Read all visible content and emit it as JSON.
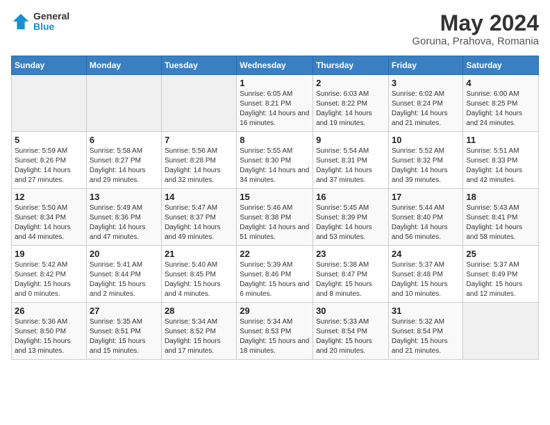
{
  "header": {
    "logo_line1": "General",
    "logo_line2": "Blue",
    "title": "May 2024",
    "subtitle": "Goruna, Prahova, Romania"
  },
  "weekdays": [
    "Sunday",
    "Monday",
    "Tuesday",
    "Wednesday",
    "Thursday",
    "Friday",
    "Saturday"
  ],
  "weeks": [
    [
      {
        "day": "",
        "info": ""
      },
      {
        "day": "",
        "info": ""
      },
      {
        "day": "",
        "info": ""
      },
      {
        "day": "1",
        "info": "Sunrise: 6:05 AM\nSunset: 8:21 PM\nDaylight: 14 hours and 16 minutes."
      },
      {
        "day": "2",
        "info": "Sunrise: 6:03 AM\nSunset: 8:22 PM\nDaylight: 14 hours and 19 minutes."
      },
      {
        "day": "3",
        "info": "Sunrise: 6:02 AM\nSunset: 8:24 PM\nDaylight: 14 hours and 21 minutes."
      },
      {
        "day": "4",
        "info": "Sunrise: 6:00 AM\nSunset: 8:25 PM\nDaylight: 14 hours and 24 minutes."
      }
    ],
    [
      {
        "day": "5",
        "info": "Sunrise: 5:59 AM\nSunset: 8:26 PM\nDaylight: 14 hours and 27 minutes."
      },
      {
        "day": "6",
        "info": "Sunrise: 5:58 AM\nSunset: 8:27 PM\nDaylight: 14 hours and 29 minutes."
      },
      {
        "day": "7",
        "info": "Sunrise: 5:56 AM\nSunset: 8:28 PM\nDaylight: 14 hours and 32 minutes."
      },
      {
        "day": "8",
        "info": "Sunrise: 5:55 AM\nSunset: 8:30 PM\nDaylight: 14 hours and 34 minutes."
      },
      {
        "day": "9",
        "info": "Sunrise: 5:54 AM\nSunset: 8:31 PM\nDaylight: 14 hours and 37 minutes."
      },
      {
        "day": "10",
        "info": "Sunrise: 5:52 AM\nSunset: 8:32 PM\nDaylight: 14 hours and 39 minutes."
      },
      {
        "day": "11",
        "info": "Sunrise: 5:51 AM\nSunset: 8:33 PM\nDaylight: 14 hours and 42 minutes."
      }
    ],
    [
      {
        "day": "12",
        "info": "Sunrise: 5:50 AM\nSunset: 8:34 PM\nDaylight: 14 hours and 44 minutes."
      },
      {
        "day": "13",
        "info": "Sunrise: 5:49 AM\nSunset: 8:36 PM\nDaylight: 14 hours and 47 minutes."
      },
      {
        "day": "14",
        "info": "Sunrise: 5:47 AM\nSunset: 8:37 PM\nDaylight: 14 hours and 49 minutes."
      },
      {
        "day": "15",
        "info": "Sunrise: 5:46 AM\nSunset: 8:38 PM\nDaylight: 14 hours and 51 minutes."
      },
      {
        "day": "16",
        "info": "Sunrise: 5:45 AM\nSunset: 8:39 PM\nDaylight: 14 hours and 53 minutes."
      },
      {
        "day": "17",
        "info": "Sunrise: 5:44 AM\nSunset: 8:40 PM\nDaylight: 14 hours and 56 minutes."
      },
      {
        "day": "18",
        "info": "Sunrise: 5:43 AM\nSunset: 8:41 PM\nDaylight: 14 hours and 58 minutes."
      }
    ],
    [
      {
        "day": "19",
        "info": "Sunrise: 5:42 AM\nSunset: 8:42 PM\nDaylight: 15 hours and 0 minutes."
      },
      {
        "day": "20",
        "info": "Sunrise: 5:41 AM\nSunset: 8:44 PM\nDaylight: 15 hours and 2 minutes."
      },
      {
        "day": "21",
        "info": "Sunrise: 5:40 AM\nSunset: 8:45 PM\nDaylight: 15 hours and 4 minutes."
      },
      {
        "day": "22",
        "info": "Sunrise: 5:39 AM\nSunset: 8:46 PM\nDaylight: 15 hours and 6 minutes."
      },
      {
        "day": "23",
        "info": "Sunrise: 5:38 AM\nSunset: 8:47 PM\nDaylight: 15 hours and 8 minutes."
      },
      {
        "day": "24",
        "info": "Sunrise: 5:37 AM\nSunset: 8:48 PM\nDaylight: 15 hours and 10 minutes."
      },
      {
        "day": "25",
        "info": "Sunrise: 5:37 AM\nSunset: 8:49 PM\nDaylight: 15 hours and 12 minutes."
      }
    ],
    [
      {
        "day": "26",
        "info": "Sunrise: 5:36 AM\nSunset: 8:50 PM\nDaylight: 15 hours and 13 minutes."
      },
      {
        "day": "27",
        "info": "Sunrise: 5:35 AM\nSunset: 8:51 PM\nDaylight: 15 hours and 15 minutes."
      },
      {
        "day": "28",
        "info": "Sunrise: 5:34 AM\nSunset: 8:52 PM\nDaylight: 15 hours and 17 minutes."
      },
      {
        "day": "29",
        "info": "Sunrise: 5:34 AM\nSunset: 8:53 PM\nDaylight: 15 hours and 18 minutes."
      },
      {
        "day": "30",
        "info": "Sunrise: 5:33 AM\nSunset: 8:54 PM\nDaylight: 15 hours and 20 minutes."
      },
      {
        "day": "31",
        "info": "Sunrise: 5:32 AM\nSunset: 8:54 PM\nDaylight: 15 hours and 21 minutes."
      },
      {
        "day": "",
        "info": ""
      }
    ]
  ]
}
